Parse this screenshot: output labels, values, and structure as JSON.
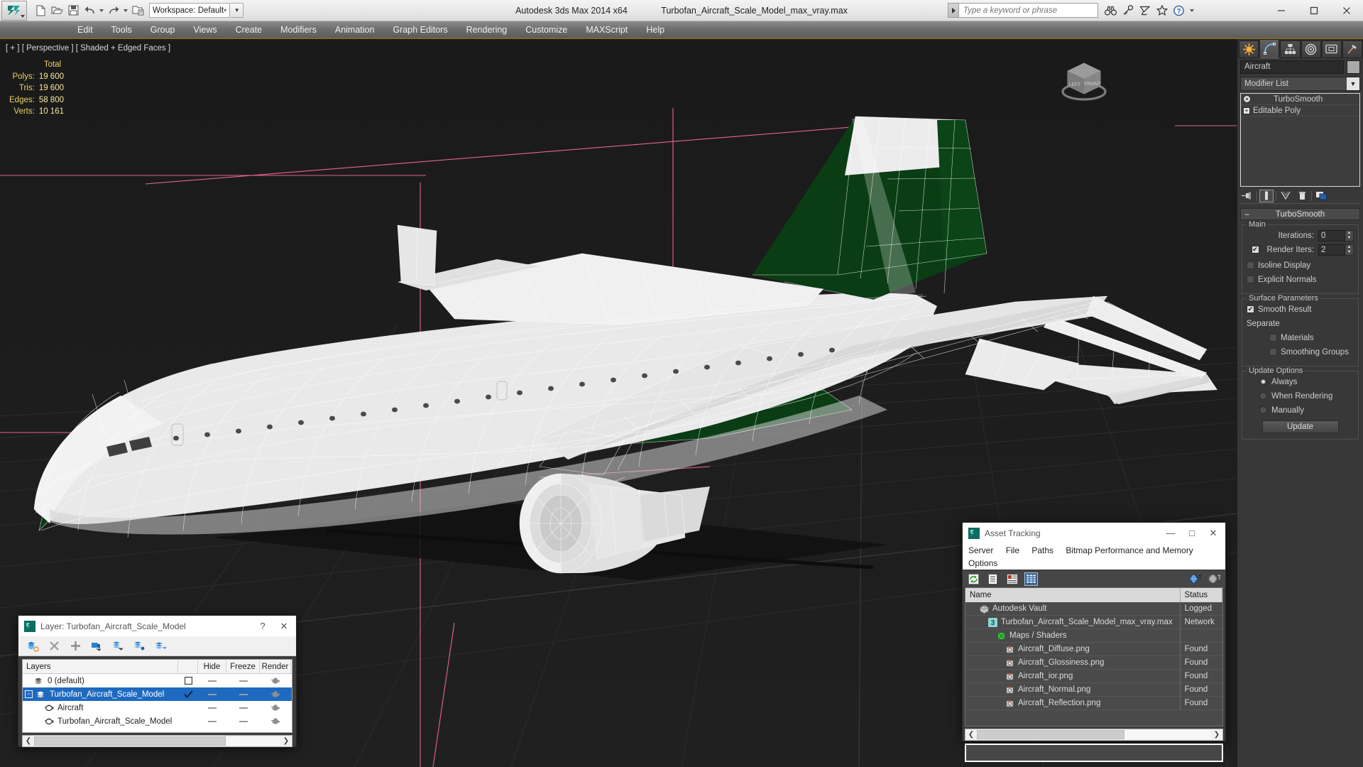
{
  "titlebar": {
    "app_title": "Autodesk 3ds Max  2014 x64",
    "file_title": "Turbofan_Aircraft_Scale_Model_max_vray.max",
    "workspace_label": "Workspace: Default",
    "search_placeholder": "Type a keyword or phrase",
    "quick_access": [
      {
        "name": "new-file-icon",
        "tip": "New"
      },
      {
        "name": "open-file-icon",
        "tip": "Open"
      },
      {
        "name": "save-file-icon",
        "tip": "Save"
      },
      {
        "name": "undo-icon",
        "tip": "Undo"
      },
      {
        "name": "redo-icon",
        "tip": "Redo"
      },
      {
        "name": "set-project-folder-icon",
        "tip": "Set Project Folder"
      }
    ],
    "help_icons": [
      {
        "name": "search-binoculars-icon"
      },
      {
        "name": "key-icon"
      },
      {
        "name": "satellite-dish-icon"
      },
      {
        "name": "favorites-star-icon"
      },
      {
        "name": "help-question-icon"
      }
    ],
    "window_controls": [
      {
        "name": "minimize-button",
        "glyph": "—"
      },
      {
        "name": "maximize-button",
        "glyph": "□"
      },
      {
        "name": "close-button",
        "glyph": "✕"
      }
    ]
  },
  "menubar": {
    "items": [
      "Edit",
      "Tools",
      "Group",
      "Views",
      "Create",
      "Modifiers",
      "Animation",
      "Graph Editors",
      "Rendering",
      "Customize",
      "MAXScript",
      "Help"
    ]
  },
  "viewport": {
    "label": "[ + ] [ Perspective ] [ Shaded + Edged Faces ]",
    "stats_header": "Total",
    "stats": [
      {
        "label": "Polys:",
        "value": "19 600"
      },
      {
        "label": "Tris:",
        "value": "19 600"
      },
      {
        "label": "Edges:",
        "value": "58 800"
      },
      {
        "label": "Verts:",
        "value": "10 161"
      }
    ],
    "viewcube_faces": [
      "LEFT",
      "FRONT"
    ],
    "colors": {
      "background": "#1d1d1d",
      "grid": "#2b2b2b",
      "selection_gizmo": "#e8648c",
      "model_white": "#e9e9e9",
      "model_green": "#0b4416",
      "wire": "#ffffff"
    }
  },
  "command_panel": {
    "tabs": [
      {
        "name": "create-tab",
        "label": "Create",
        "active": false
      },
      {
        "name": "modify-tab",
        "label": "Modify",
        "active": true
      },
      {
        "name": "hierarchy-tab",
        "label": "Hierarchy",
        "active": false
      },
      {
        "name": "motion-tab",
        "label": "Motion",
        "active": false
      },
      {
        "name": "display-tab",
        "label": "Display",
        "active": false
      },
      {
        "name": "utilities-tab",
        "label": "Utilities",
        "active": false
      }
    ],
    "object_name": "Aircraft",
    "modifier_list_label": "Modifier List",
    "stack": [
      {
        "label": "TurboSmooth",
        "type": "modifier"
      },
      {
        "label": "Editable Poly",
        "type": "base"
      }
    ],
    "stack_buttons": [
      {
        "name": "pin-stack-button"
      },
      {
        "name": "show-end-result-button",
        "active": true
      },
      {
        "name": "make-unique-button"
      },
      {
        "name": "remove-modifier-button"
      },
      {
        "name": "configure-modifier-sets-button"
      }
    ],
    "rollout": {
      "title": "TurboSmooth",
      "groups": [
        {
          "title": "Main",
          "fields": [
            {
              "type": "spinner",
              "label": "Iterations:",
              "value": "0",
              "checkbox": null
            },
            {
              "type": "spinner",
              "label": "Render Iters:",
              "value": "2",
              "checkbox": true
            },
            {
              "type": "checkbox",
              "label": "Isoline Display",
              "checked": false
            },
            {
              "type": "checkbox",
              "label": "Explicit Normals",
              "checked": false
            }
          ]
        },
        {
          "title": "Surface Parameters",
          "fields": [
            {
              "type": "checkbox",
              "label": "Smooth Result",
              "checked": true
            },
            {
              "type": "text",
              "label": "Separate"
            },
            {
              "type": "checkbox",
              "label": "Materials",
              "checked": false,
              "indent": true
            },
            {
              "type": "checkbox",
              "label": "Smoothing Groups",
              "checked": false,
              "indent": true
            }
          ]
        },
        {
          "title": "Update Options",
          "fields": [
            {
              "type": "radio",
              "label": "Always",
              "checked": true
            },
            {
              "type": "radio",
              "label": "When Rendering",
              "checked": false
            },
            {
              "type": "radio",
              "label": "Manually",
              "checked": false
            },
            {
              "type": "button",
              "label": "Update"
            }
          ]
        }
      ]
    }
  },
  "layer_dialog": {
    "title": "Layer: Turbofan_Aircraft_Scale_Model",
    "title_buttons": [
      {
        "name": "help-button",
        "glyph": "?"
      },
      {
        "name": "close-button",
        "glyph": "✕"
      }
    ],
    "toolbar": [
      {
        "name": "create-new-layer-icon"
      },
      {
        "name": "delete-layer-icon"
      },
      {
        "name": "add-selection-to-layer-icon"
      },
      {
        "name": "select-objects-in-layer-icon"
      },
      {
        "name": "select-highlighted-objects-icon"
      },
      {
        "name": "highlight-selected-objects-icon"
      },
      {
        "name": "hide-unhide-layer-icon"
      }
    ],
    "columns": [
      "Layers",
      "",
      "Hide",
      "Freeze",
      "Render"
    ],
    "rows": [
      {
        "name": "0 (default)",
        "indent": 0,
        "icon": "layer-icon",
        "selected": false,
        "current": false,
        "box": true
      },
      {
        "name": "Turbofan_Aircraft_Scale_Model",
        "indent": 0,
        "icon": "layer-icon",
        "selected": true,
        "current": true,
        "expander": "-"
      },
      {
        "name": "Aircraft",
        "indent": 1,
        "icon": "teapot-icon",
        "selected": false,
        "current": false
      },
      {
        "name": "Turbofan_Aircraft_Scale_Model",
        "indent": 1,
        "icon": "teapot-icon",
        "selected": false,
        "current": false
      }
    ]
  },
  "asset_tracking": {
    "title": "Asset Tracking",
    "window_controls": [
      {
        "name": "minimize-button",
        "glyph": "—"
      },
      {
        "name": "maximize-button",
        "glyph": "□"
      },
      {
        "name": "close-button",
        "glyph": "✕"
      }
    ],
    "menus": [
      "Server",
      "File",
      "Paths",
      "Bitmap Performance and Memory",
      "Options"
    ],
    "toolbar": [
      {
        "name": "refresh-icon",
        "active": false
      },
      {
        "name": "list-view-icon",
        "active": false
      },
      {
        "name": "path-view-icon",
        "active": false
      },
      {
        "name": "grid-view-icon",
        "active": true
      },
      {
        "name": "help-globe-icon",
        "active": false
      },
      {
        "name": "help-icon",
        "active": false
      }
    ],
    "columns": [
      "Name",
      "Status"
    ],
    "rows": [
      {
        "name": "Autodesk Vault",
        "status": "Logged",
        "indent": 0,
        "icon": "vault-icon"
      },
      {
        "name": "Turbofan_Aircraft_Scale_Model_max_vray.max",
        "status": "Network",
        "indent": 1,
        "icon": "max-file-icon"
      },
      {
        "name": "Maps / Shaders",
        "status": "",
        "indent": 2,
        "icon": "maps-icon"
      },
      {
        "name": "Aircraft_Diffuse.png",
        "status": "Found",
        "indent": 3,
        "icon": "bitmap-icon"
      },
      {
        "name": "Aircraft_Glossiness.png",
        "status": "Found",
        "indent": 3,
        "icon": "bitmap-icon"
      },
      {
        "name": "Aircraft_ior.png",
        "status": "Found",
        "indent": 3,
        "icon": "bitmap-icon"
      },
      {
        "name": "Aircraft_Normal.png",
        "status": "Found",
        "indent": 3,
        "icon": "bitmap-icon"
      },
      {
        "name": "Aircraft_Reflection.png",
        "status": "Found",
        "indent": 3,
        "icon": "bitmap-icon"
      }
    ]
  }
}
